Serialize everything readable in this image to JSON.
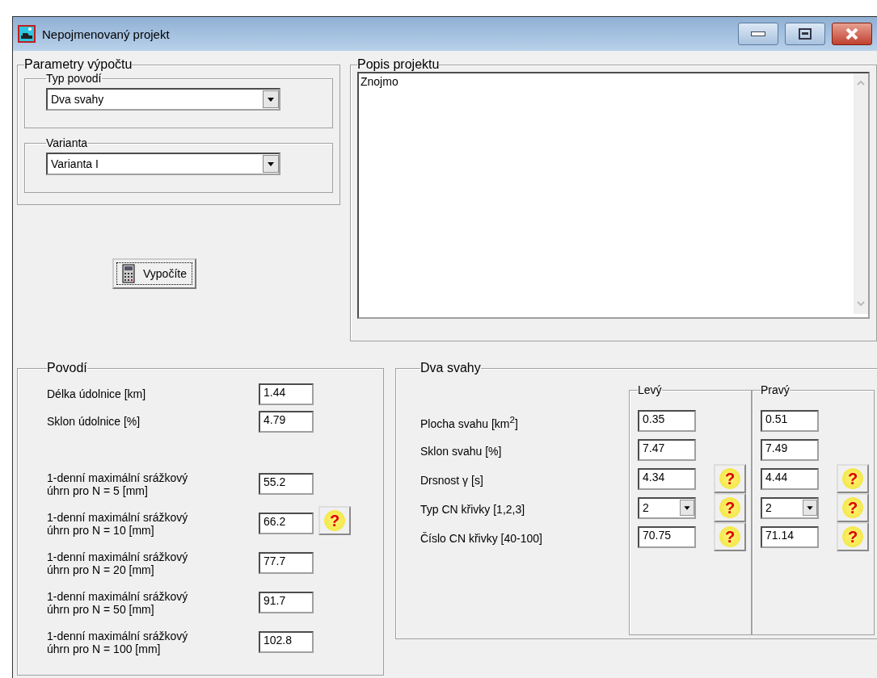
{
  "window": {
    "title": "Nepojmenovaný projekt"
  },
  "parameters": {
    "title": "Parametry výpočtu",
    "groups": [
      {
        "title": "Typ povodí",
        "value": "Dva svahy"
      },
      {
        "title": "Varianta",
        "value": "Varianta I"
      }
    ]
  },
  "compute_button": {
    "label": "Vypočíte"
  },
  "description": {
    "title": "Popis projektu",
    "value": "Znojmo"
  },
  "basin": {
    "title": "Povodí",
    "fields": [
      {
        "label": "Délka údolnice [km]",
        "value": "1.44"
      },
      {
        "label": "Sklon údolnice [%]",
        "value": "4.79"
      }
    ],
    "rainfall_help": "?",
    "rainfall": [
      {
        "label": "1-denní maximální srážkový\núhrn pro N = 5 [mm]",
        "value": "55.2"
      },
      {
        "label": "1-denní maximální srážkový\núhrn pro N = 10 [mm]",
        "value": "66.2"
      },
      {
        "label": "1-denní maximální srážkový\núhrn pro N = 20 [mm]",
        "value": "77.7"
      },
      {
        "label": "1-denní maximální srážkový\núhrn pro N = 50 [mm]",
        "value": "91.7"
      },
      {
        "label": "1-denní maximální srážkový\núhrn pro N = 100 [mm]",
        "value": "102.8"
      }
    ]
  },
  "slopes": {
    "title": "Dva svahy",
    "rows": [
      {
        "label": "Plocha svahu [km$^{2}$]",
        "kind": "text"
      },
      {
        "label": "Sklon svahu [%]",
        "kind": "text"
      },
      {
        "label": "Drsnost  γ  [s]",
        "kind": "text",
        "help": "?"
      },
      {
        "label": "Typ CN křivky [1,2,3]",
        "kind": "select",
        "help": "?"
      },
      {
        "label": "Číslo CN křivky [40-100]",
        "kind": "text",
        "help": "?"
      }
    ],
    "columns": [
      {
        "title": "Levý",
        "values": [
          "0.35",
          "7.47",
          "4.34",
          "2",
          "70.75"
        ]
      },
      {
        "title": "Pravý",
        "values": [
          "0.51",
          "7.49",
          "4.44",
          "2",
          "71.14"
        ]
      }
    ]
  }
}
